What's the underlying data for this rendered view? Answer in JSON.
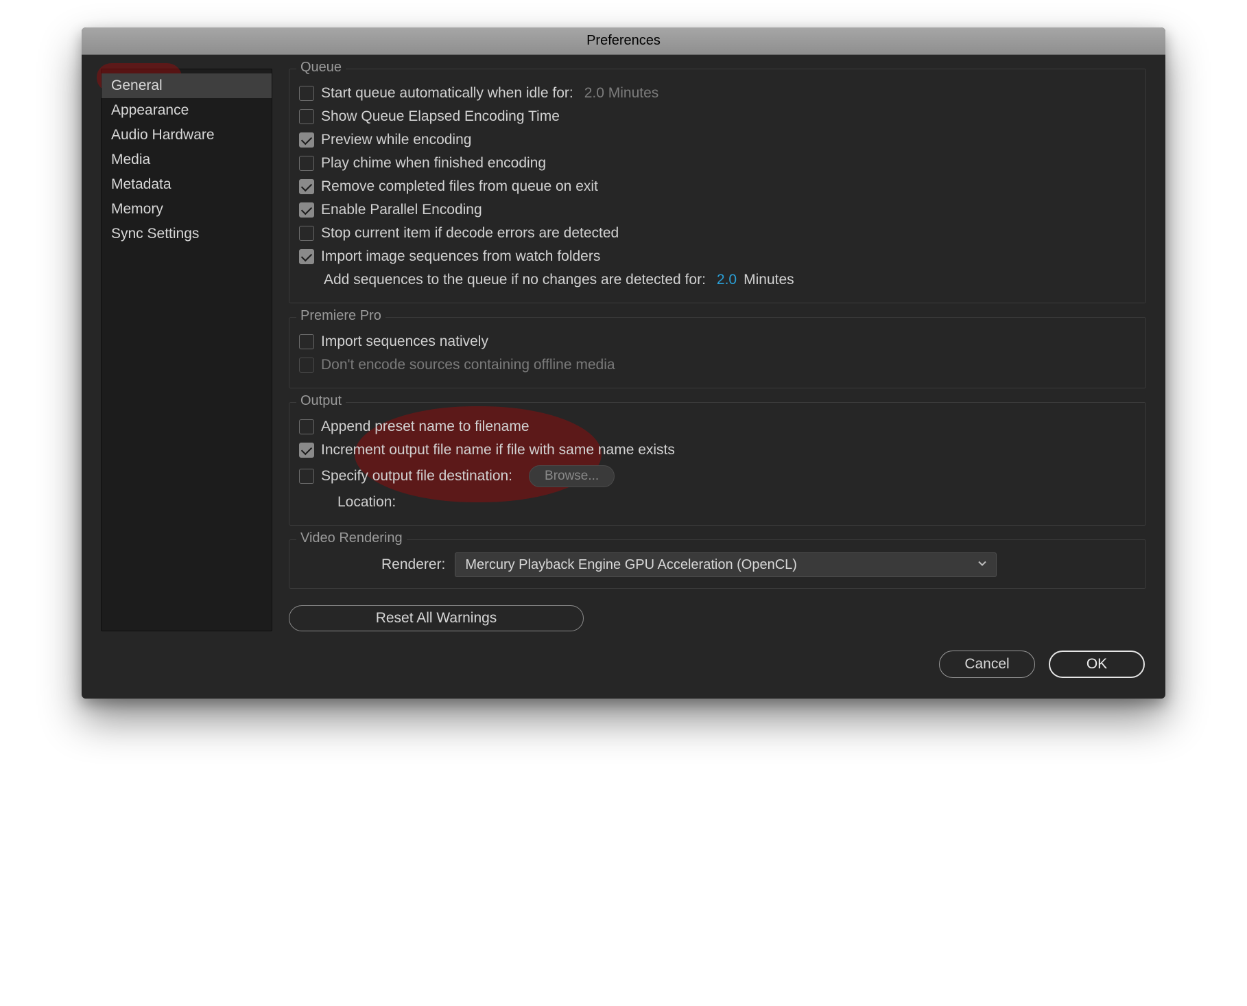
{
  "window": {
    "title": "Preferences"
  },
  "sidebar": {
    "items": [
      {
        "label": "General",
        "selected": true
      },
      {
        "label": "Appearance"
      },
      {
        "label": "Audio Hardware"
      },
      {
        "label": "Media"
      },
      {
        "label": "Metadata"
      },
      {
        "label": "Memory"
      },
      {
        "label": "Sync Settings"
      }
    ]
  },
  "groups": {
    "queue": {
      "title": "Queue",
      "start_auto_label": "Start queue automatically when idle for:",
      "start_auto_value": "2.0 Minutes",
      "show_elapsed": "Show Queue Elapsed Encoding Time",
      "preview": "Preview while encoding",
      "chime": "Play chime when finished encoding",
      "remove_completed": "Remove completed files from queue on exit",
      "parallel": "Enable Parallel Encoding",
      "stop_on_decode": "Stop current item if decode errors are detected",
      "import_watch": "Import image sequences from watch folders",
      "add_seq_label": "Add sequences to the queue if no changes are detected for:",
      "add_seq_value": "2.0",
      "add_seq_unit": "Minutes"
    },
    "premiere": {
      "title": "Premiere Pro",
      "import_native": "Import sequences natively",
      "dont_encode_offline": "Don't encode sources containing offline media"
    },
    "output": {
      "title": "Output",
      "append_preset": "Append preset name to filename",
      "increment": "Increment output file name if file with same name exists",
      "specify_dest": "Specify output file destination:",
      "browse": "Browse...",
      "location_label": "Location:"
    },
    "video": {
      "title": "Video Rendering",
      "renderer_label": "Renderer:",
      "renderer_value": "Mercury Playback Engine GPU Acceleration (OpenCL)"
    }
  },
  "buttons": {
    "reset": "Reset All Warnings",
    "cancel": "Cancel",
    "ok": "OK"
  }
}
